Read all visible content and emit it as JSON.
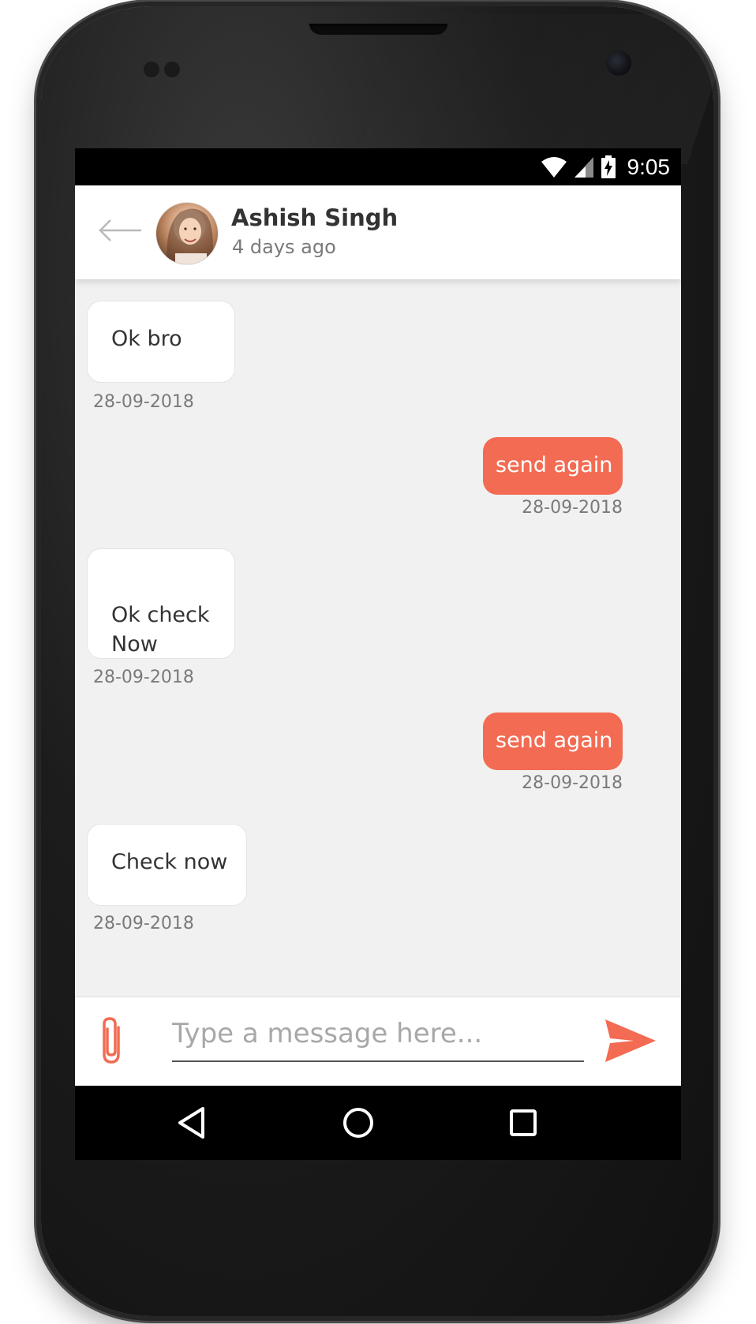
{
  "status_bar": {
    "time": "9:05",
    "icons": [
      "wifi-icon",
      "cell-signal-icon",
      "battery-charging-icon"
    ]
  },
  "header": {
    "back_icon": "arrow-left-icon",
    "contact_name": "Ashish Singh",
    "contact_status": "4 days ago",
    "avatar": "contact-avatar"
  },
  "messages": [
    {
      "direction": "incoming",
      "text": "Ok bro",
      "date": "28-09-2018"
    },
    {
      "direction": "outgoing",
      "text": "send again",
      "date": "28-09-2018"
    },
    {
      "direction": "incoming",
      "text": "Ok check\nNow",
      "date": "28-09-2018"
    },
    {
      "direction": "outgoing",
      "text": "send again",
      "date": "28-09-2018"
    },
    {
      "direction": "incoming",
      "text": "Check now",
      "date": "28-09-2018"
    }
  ],
  "composer": {
    "attach_icon": "paperclip-icon",
    "placeholder": "Type a message here...",
    "value": "",
    "send_icon": "send-icon"
  },
  "nav_bar": {
    "icons": [
      "back-triangle-icon",
      "home-circle-icon",
      "recents-square-icon"
    ]
  },
  "colors": {
    "accent": "#f26b52",
    "chat_background": "#f1f1f1",
    "incoming_bubble": "#ffffff",
    "text_primary": "#333333",
    "text_secondary": "#7a7a7a"
  }
}
